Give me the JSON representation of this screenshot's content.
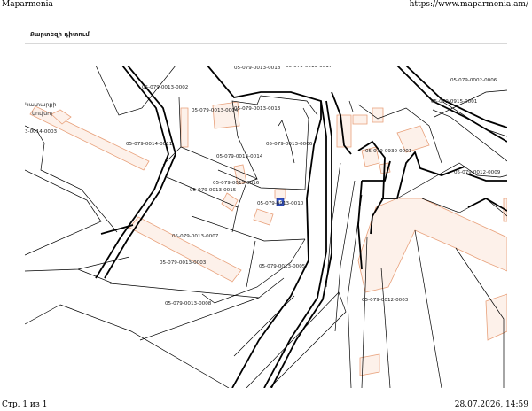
{
  "page_header": {
    "site_name": "Maparmenia",
    "url": "https://www.maparmenia.am/"
  },
  "page_footer": {
    "page_number": "Стр. 1 из 1",
    "timestamp": "28.07.2026, 14:59"
  },
  "map_panel": {
    "title": "Քարտեզի դիտում"
  },
  "colors": {
    "parcel_outline": "#e8a07a",
    "parcel_fill": "#fdf1ea",
    "boundary": "#000000",
    "marker": "#3355cc"
  },
  "map": {
    "place_label": [
      "Կատարքի",
      "կուխոյ"
    ],
    "parcel_labels": [
      "05-079-0013-0002",
      "05-079-0013-0004",
      "05-079-0013-0013",
      "05-079-0014-0011",
      "3-0014-0003",
      "05-079-0013-0006",
      "05-079-0013-0014",
      "05-079-0013-0016",
      "05-079-0013-0015",
      "05-079-0013-0010",
      "05-079-0013-0007",
      "05-079-0013-0003",
      "05-079-0013-0005",
      "05-079-0013-0008",
      "05-079-0012-0003",
      "05-079-0930-0001",
      "05-079-0012-0009",
      "05-079-0915-0001",
      "05-079-0002-0006",
      "05-079-0013-0018",
      "05-079-0013-0017"
    ]
  }
}
